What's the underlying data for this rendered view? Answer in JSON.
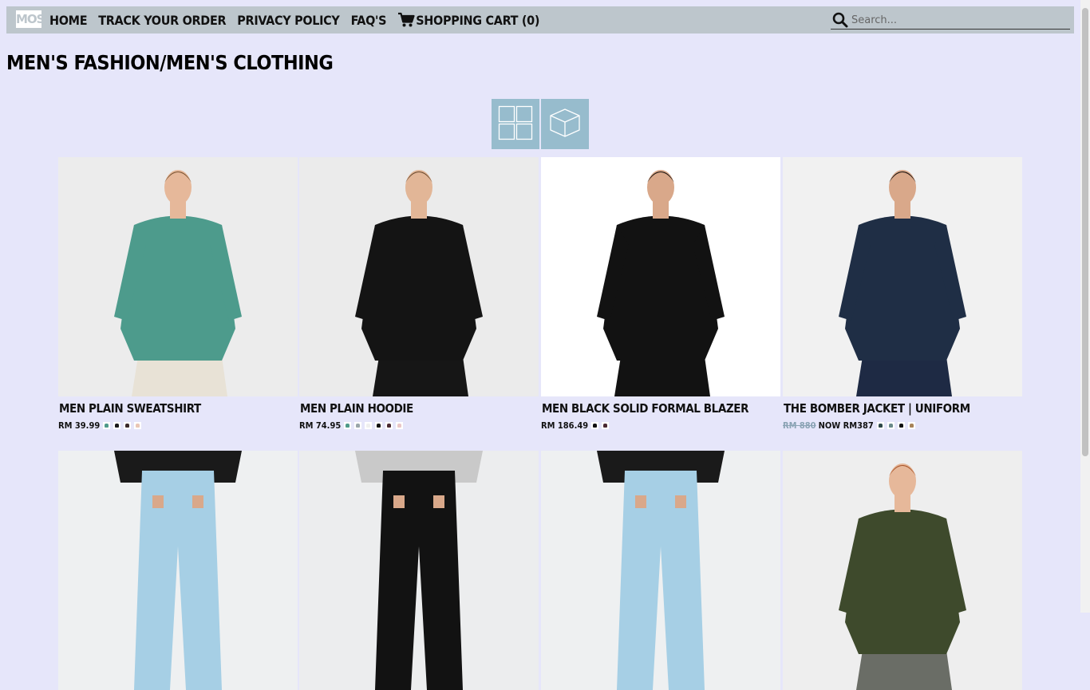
{
  "nav": {
    "logo_text": "MOS",
    "links": [
      "HOME",
      "TRACK YOUR ORDER",
      "PRIVACY POLICY",
      "FAQ'S"
    ],
    "cart_label": "SHOPPING CART (0)",
    "search_placeholder": "Search..."
  },
  "page_title": "MEN'S FASHION/MEN'S CLOTHING",
  "view_toggles": [
    "grid-view-icon",
    "cube-view-icon"
  ],
  "products": [
    {
      "name": "MEN PLAIN SWEATSHIRT",
      "price": "RM 39.99",
      "swatches": [
        "#4f9a8a",
        "#1a1a1a",
        "#3b2a2a",
        "#e9c6b5"
      ],
      "image": {
        "bg": "#ececec",
        "top": "#4d9b8c",
        "bottom": "#e8e2d6",
        "skin": "#e6b89a",
        "hair": "#7a5432"
      }
    },
    {
      "name": "MEN PLAIN HOODIE",
      "price": "RM 74.95",
      "swatches": [
        "#4f9a8a",
        "#9aa6aa",
        "#efefef",
        "#111111",
        "#4a2a32",
        "#e9c6c6"
      ],
      "image": {
        "bg": "#ebebeb",
        "top": "#141414",
        "bottom": "#161616",
        "skin": "#e2b697",
        "hair": "#6a4a2e"
      }
    },
    {
      "name": "MEN BLACK SOLID FORMAL BLAZER",
      "price": "RM 186.49",
      "swatches": [
        "#111111",
        "#4a2a32"
      ],
      "image": {
        "bg": "#ffffff",
        "top": "#121212",
        "bottom": "#121212",
        "skin": "#d9a88a",
        "hair": "#1a1410"
      }
    },
    {
      "name": "THE BOMBER JACKET | UNIFORM",
      "old_price": "RM 880",
      "price": "NOW RM387",
      "swatches": [
        "#2f4a4a",
        "#6b8a8a",
        "#111111",
        "#a8845a"
      ],
      "image": {
        "bg": "#f1f1f1",
        "top": "#1f2e45",
        "bottom": "#1e2a44",
        "skin": "#d9a88a",
        "hair": "#1a1410"
      }
    },
    {
      "name": "",
      "price": "",
      "swatches": [],
      "image": {
        "bg": "#eef0f1",
        "top": "#1a1a1a",
        "bottom": "#a6cfe5",
        "skin": "#d9a88a",
        "hair": "#1a1410"
      }
    },
    {
      "name": "",
      "price": "",
      "swatches": [],
      "image": {
        "bg": "#ecedee",
        "top": "#c9c9c9",
        "bottom": "#121212",
        "skin": "#d9a88a",
        "hair": "#1a1410"
      }
    },
    {
      "name": "",
      "price": "",
      "swatches": [],
      "image": {
        "bg": "#eef0f1",
        "top": "#1a1a1a",
        "bottom": "#a6cfe5",
        "skin": "#d9a88a",
        "hair": "#1a1410"
      }
    },
    {
      "name": "",
      "price": "",
      "swatches": [],
      "image": {
        "bg": "#eeeeee",
        "top": "#3e4a2c",
        "bottom": "#6a6d66",
        "skin": "#e6b89a",
        "hair": "#a8552a"
      }
    }
  ]
}
